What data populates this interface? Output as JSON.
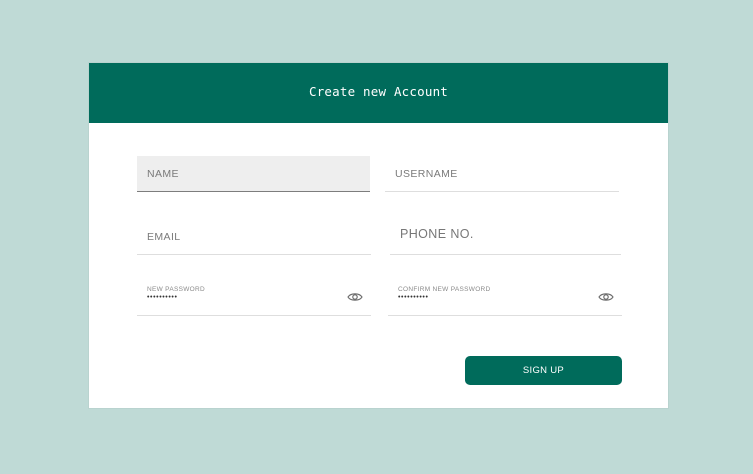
{
  "header": {
    "title": "Create new Account"
  },
  "form": {
    "name": {
      "placeholder": "NAME"
    },
    "username": {
      "placeholder": "USERNAME"
    },
    "email": {
      "placeholder": "EMAIL"
    },
    "phone": {
      "placeholder": "PHONE NO."
    },
    "new_password": {
      "label": "NEW PASSWORD",
      "value": "••••••••••",
      "icon": "eye-icon"
    },
    "confirm_password": {
      "label": "CONFIRM NEW PASSWORD",
      "value": "••••••••••",
      "icon": "eye-icon"
    },
    "submit_label": "SIGN UP"
  },
  "colors": {
    "background": "#bfdad6",
    "accent": "#006b5b",
    "card": "#ffffff",
    "active_field": "#eeeeee"
  }
}
